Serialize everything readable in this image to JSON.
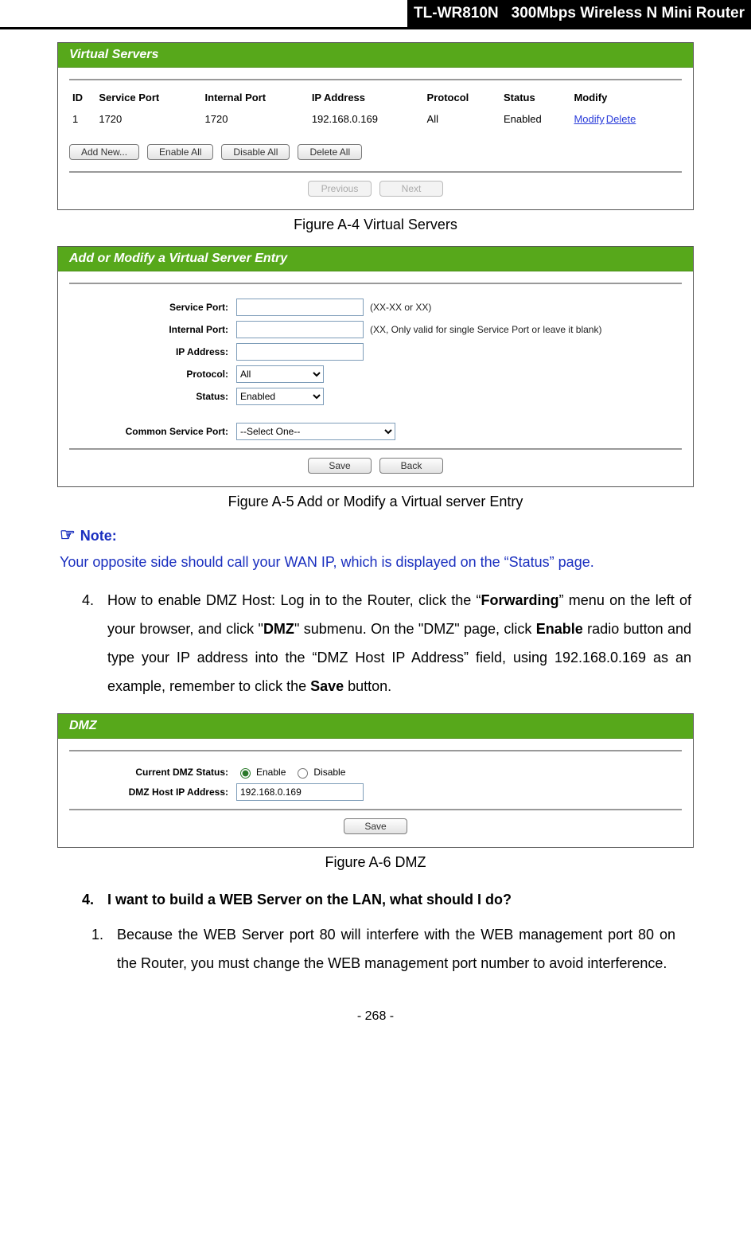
{
  "header": {
    "model": "TL-WR810N",
    "model_name": "300Mbps Wireless N Mini Router"
  },
  "figA4": {
    "titlebar": "Virtual Servers",
    "headers": {
      "id": "ID",
      "service_port": "Service Port",
      "internal_port": "Internal Port",
      "ip_address": "IP Address",
      "protocol": "Protocol",
      "status": "Status",
      "modify": "Modify"
    },
    "row": {
      "id": "1",
      "service_port": "1720",
      "internal_port": "1720",
      "ip_address": "192.168.0.169",
      "protocol": "All",
      "status": "Enabled",
      "modify": "Modify",
      "delete": "Delete"
    },
    "buttons": {
      "add_new": "Add New...",
      "enable_all": "Enable All",
      "disable_all": "Disable All",
      "delete_all": "Delete All",
      "previous": "Previous",
      "next": "Next"
    },
    "caption": "Figure A-4 Virtual Servers"
  },
  "figA5": {
    "titlebar": "Add or Modify a Virtual Server Entry",
    "labels": {
      "service_port": "Service Port:",
      "internal_port": "Internal Port:",
      "ip_address": "IP Address:",
      "protocol": "Protocol:",
      "status": "Status:",
      "common_service_port": "Common Service Port:"
    },
    "values": {
      "protocol": "All",
      "status": "Enabled",
      "common_service_port": "--Select One--"
    },
    "hints": {
      "service_port": "(XX-XX or XX)",
      "internal_port": "(XX, Only valid for single Service Port or leave it blank)"
    },
    "buttons": {
      "save": "Save",
      "back": "Back"
    },
    "caption": "Figure A-5 Add or Modify a Virtual server Entry"
  },
  "note": {
    "icon": "☞",
    "label": "Note:",
    "body": "Your opposite side should call your WAN IP, which is displayed on the “Status” page."
  },
  "step4": {
    "prefix": "How to enable DMZ Host: Log in to the Router, click the “",
    "forwarding": "Forwarding",
    "after_forwarding": "” menu on the left of your browser, and click \"",
    "dmz": "DMZ",
    "after_dmz": "\" submenu. On the \"DMZ\" page, click ",
    "enable": "Enable",
    "after_enable": " radio button and type your IP address into the “DMZ Host IP Address” field, using 192.168.0.169 as an example, remember to click the ",
    "save": "Save",
    "suffix": " button."
  },
  "figA6": {
    "titlebar": "DMZ",
    "labels": {
      "current_status": "Current DMZ Status:",
      "host_ip": "DMZ Host IP Address:",
      "enable": "Enable",
      "disable": "Disable"
    },
    "values": {
      "host_ip": "192.168.0.169"
    },
    "buttons": {
      "save": "Save"
    },
    "caption": "Figure A-6 DMZ"
  },
  "q4": {
    "heading": "I want to build a WEB Server on the LAN, what should I do?",
    "step1": "Because the WEB Server port 80 will interfere with the WEB management port 80 on the Router, you must change the WEB management port number to avoid interference."
  },
  "page_number": "- 268 -"
}
